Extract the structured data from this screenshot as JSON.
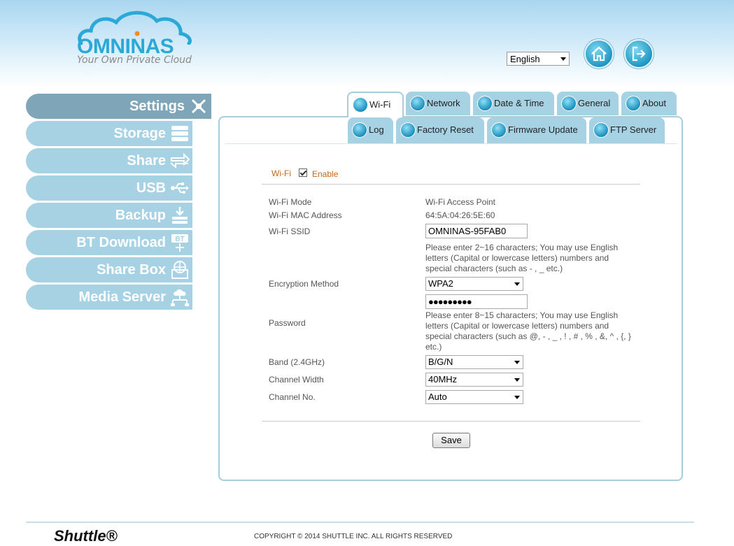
{
  "brand": {
    "name": "OMNINAS",
    "tagline": "Your Own Private Cloud"
  },
  "language": {
    "selected": "English"
  },
  "header_icons": [
    "home-icon",
    "logout-icon"
  ],
  "sidebar": {
    "items": [
      {
        "label": "Settings",
        "icon": "settings-icon",
        "active": true
      },
      {
        "label": "Storage",
        "icon": "storage-icon"
      },
      {
        "label": "Share",
        "icon": "share-icon"
      },
      {
        "label": "USB",
        "icon": "usb-icon"
      },
      {
        "label": "Backup",
        "icon": "backup-icon"
      },
      {
        "label": "BT Download",
        "icon": "bt-download-icon"
      },
      {
        "label": "Share Box",
        "icon": "share-box-icon"
      },
      {
        "label": "Media Server",
        "icon": "media-server-icon"
      }
    ]
  },
  "tabs": {
    "row1": [
      {
        "label": "Wi-Fi",
        "icon": "wifi-icon",
        "active": true
      },
      {
        "label": "Network",
        "icon": "network-icon"
      },
      {
        "label": "Date & Time",
        "icon": "clock-icon"
      },
      {
        "label": "General",
        "icon": "gears-icon"
      },
      {
        "label": "About",
        "icon": "info-icon"
      }
    ],
    "row2": [
      {
        "label": "Log",
        "icon": "log-icon"
      },
      {
        "label": "Factory Reset",
        "icon": "reset-icon"
      },
      {
        "label": "Firmware Update",
        "icon": "update-icon"
      },
      {
        "label": "FTP Server",
        "icon": "ftp-icon"
      }
    ]
  },
  "wifi": {
    "section_title": "Wi-Fi",
    "enable_label": "Enable",
    "enabled": true,
    "mode_label": "Wi-Fi Mode",
    "mode_value": "Wi-Fi Access Point",
    "mac_label": "Wi-Fi MAC Address",
    "mac_value": "64:5A:04:26:5E:60",
    "ssid_label": "Wi-Fi SSID",
    "ssid_value": "OMNINAS-95FAB0",
    "ssid_hint": "Please enter 2~16 characters; You may use English letters (Capital or lowercase letters) numbers and special characters (such as - , _ etc.)",
    "encryption_label": "Encryption Method",
    "encryption_value": "WPA2",
    "password_label": "Password",
    "password_value": "●●●●●●●●●",
    "password_hint": "Please enter 8~15 characters; You may use English letters (Capital or lowercase letters) numbers and special characters (such as @, - , _ , ! , # , % , &, ^ , {, } etc.)",
    "band_label": "Band (2.4GHz)",
    "band_value": "B/G/N",
    "width_label": "Channel Width",
    "width_value": "40MHz",
    "channel_label": "Channel No.",
    "channel_value": "Auto",
    "save_label": "Save"
  },
  "footer": {
    "brand": "Shuttle®",
    "copyright": "COPYRIGHT © 2014 SHUTTLE INC. ALL RIGHTS RESERVED"
  },
  "colors": {
    "accent": "#2aa8d8",
    "sidebar": "#a7d2e4",
    "sidebar_active": "#7ea6b8",
    "section_title": "#c26a1e"
  }
}
